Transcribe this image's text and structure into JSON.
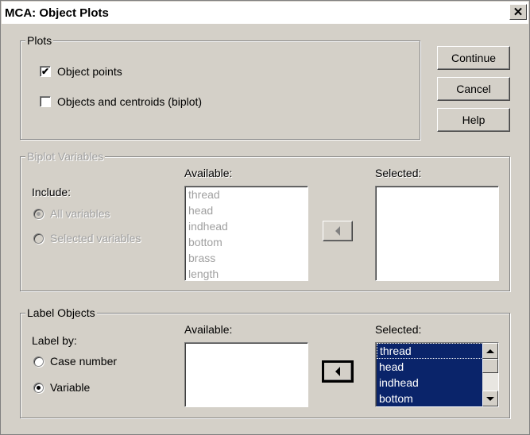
{
  "window": {
    "title": "MCA: Object Plots",
    "close_glyph": "✕"
  },
  "plots": {
    "legend": "Plots",
    "object_points": {
      "label": "Object points",
      "checked": true
    },
    "objects_centroids": {
      "label": "Objects and centroids (biplot)",
      "checked": false
    }
  },
  "buttons": {
    "continue": "Continue",
    "cancel": "Cancel",
    "help": "Help"
  },
  "biplot": {
    "legend": "Biplot Variables",
    "include_label": "Include:",
    "all_variables": "All variables",
    "selected_variables": "Selected variables",
    "available_label": "Available:",
    "selected_label": "Selected:",
    "available_items": [
      "thread",
      "head",
      "indhead",
      "bottom",
      "brass",
      "length"
    ]
  },
  "label_objects": {
    "legend": "Label Objects",
    "label_by": "Label by:",
    "case_number": "Case number",
    "variable": "Variable",
    "available_label": "Available:",
    "selected_label": "Selected:",
    "selected_items": [
      "thread",
      "head",
      "indhead",
      "bottom"
    ]
  },
  "colors": {
    "dialog_bg": "#d4d0c8",
    "selection_bg": "#0a246a",
    "disabled_text": "#a0a0a0"
  }
}
